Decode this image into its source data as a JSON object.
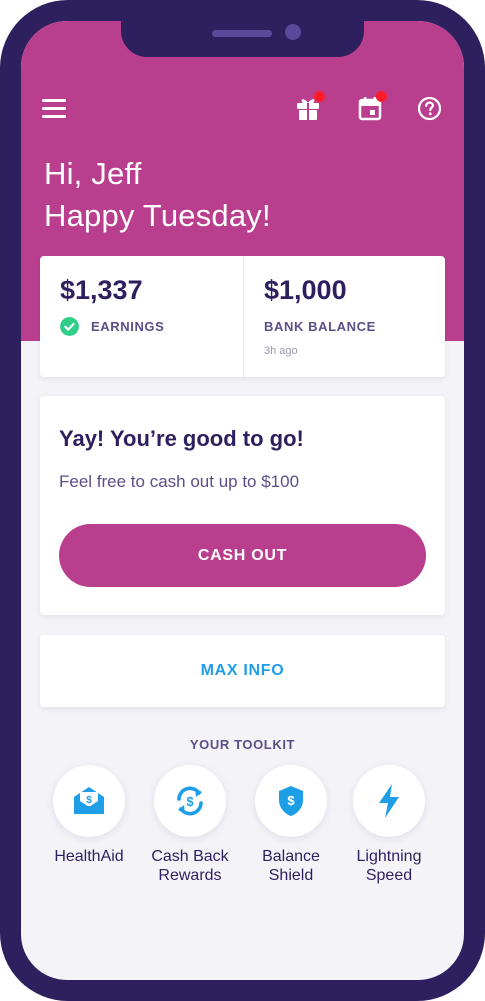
{
  "greeting": {
    "line1": "Hi, Jeff",
    "line2": "Happy Tuesday!"
  },
  "header_icons": [
    "menu-icon",
    "gift-icon",
    "calendar-icon",
    "help-icon"
  ],
  "balances": {
    "earnings": {
      "amount": "$1,337",
      "label": "EARNINGS"
    },
    "bank": {
      "amount": "$1,000",
      "label": "BANK BALANCE",
      "updated": "3h ago"
    }
  },
  "status_card": {
    "title": "Yay! You’re good to go!",
    "subtitle": "Feel free to cash out up to $100",
    "button": "CASH OUT"
  },
  "max_info": {
    "label": "MAX INFO"
  },
  "toolkit": {
    "title": "YOUR TOOLKIT",
    "items": [
      {
        "line1": "HealthAid",
        "line2": "",
        "icon": "envelope-dollar-icon"
      },
      {
        "line1": "Cash Back",
        "line2": "Rewards",
        "icon": "refresh-dollar-icon"
      },
      {
        "line1": "Balance",
        "line2": "Shield",
        "icon": "shield-dollar-icon"
      },
      {
        "line1": "Lightning",
        "line2": "Speed",
        "icon": "lightning-icon"
      }
    ]
  },
  "colors": {
    "brand_magenta": "#b93f8e",
    "deep_purple": "#2e1f5e",
    "link_blue": "#1f9ee8",
    "success_green": "#2fcf8a",
    "notification_red": "#ff1c2a"
  }
}
